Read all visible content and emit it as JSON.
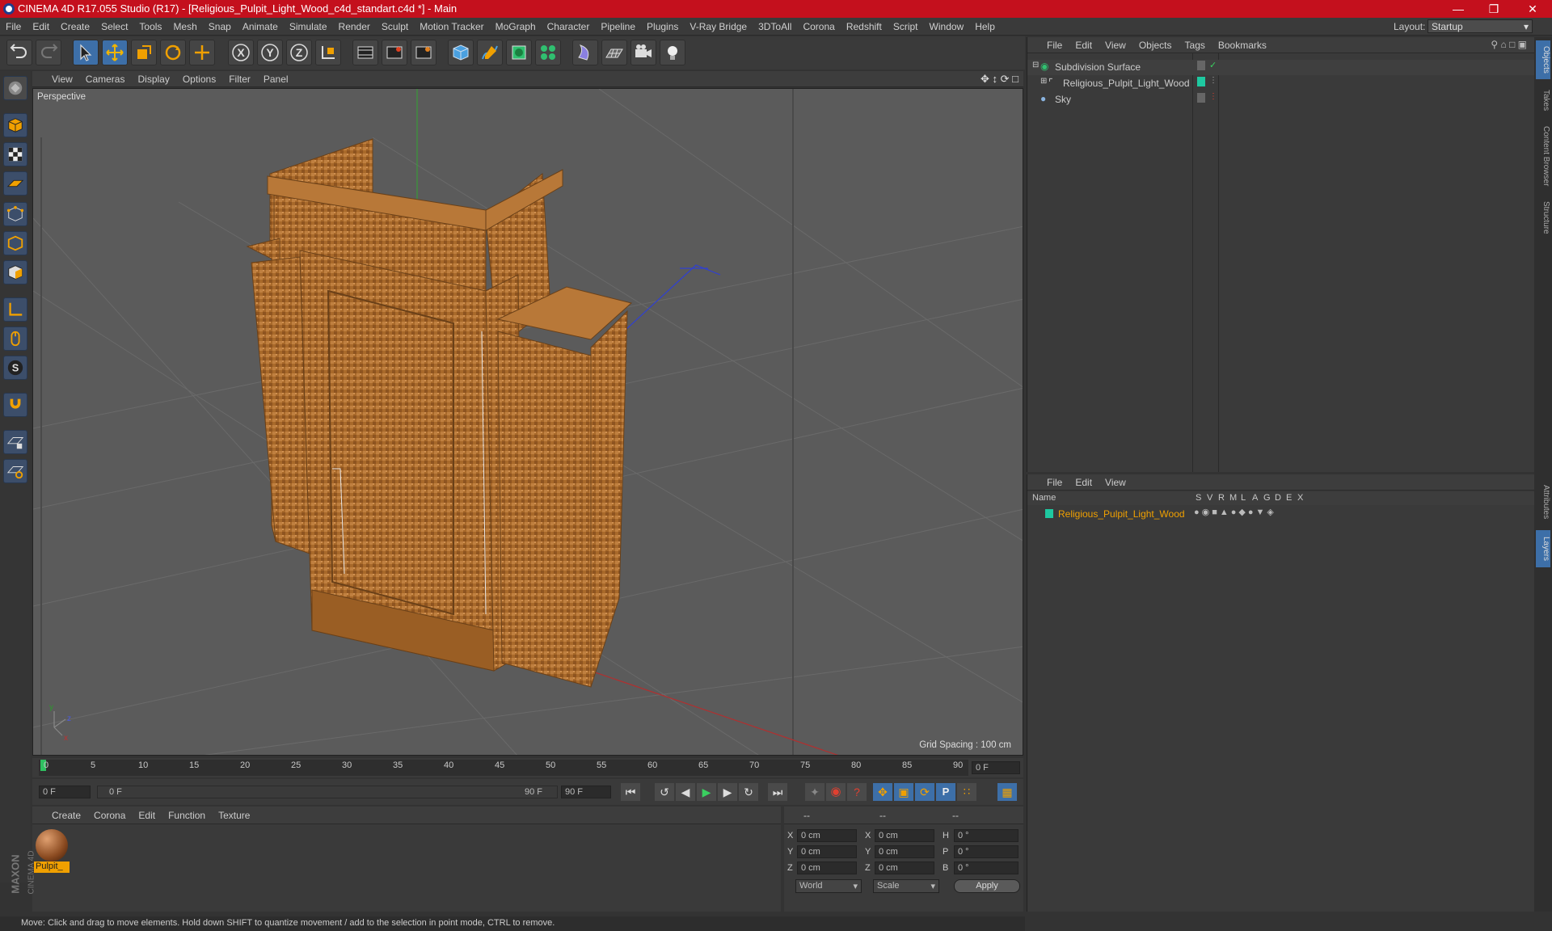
{
  "app": {
    "title": "CINEMA 4D R17.055 Studio (R17) - [Religious_Pulpit_Light_Wood_c4d_standart.c4d *] - Main"
  },
  "menubar": {
    "items": [
      "File",
      "Edit",
      "Create",
      "Select",
      "Tools",
      "Mesh",
      "Snap",
      "Animate",
      "Simulate",
      "Render",
      "Sculpt",
      "Motion Tracker",
      "MoGraph",
      "Character",
      "Pipeline",
      "Plugins",
      "V-Ray Bridge",
      "3DToAll",
      "Corona",
      "Redshift",
      "Script",
      "Window",
      "Help"
    ],
    "layout_label": "Layout:",
    "layout_value": "Startup"
  },
  "viewport": {
    "menu": [
      "View",
      "Cameras",
      "Display",
      "Options",
      "Filter",
      "Panel"
    ],
    "label": "Perspective",
    "grid_spacing": "Grid Spacing : 100 cm"
  },
  "timeline": {
    "ticks": [
      "0",
      "5",
      "10",
      "15",
      "20",
      "25",
      "30",
      "35",
      "40",
      "45",
      "50",
      "55",
      "60",
      "65",
      "70",
      "75",
      "80",
      "85",
      "90"
    ],
    "current_frame": "0 F",
    "start_field": "0 F",
    "range_start": "0 F",
    "range_end": "90 F",
    "end_field": "90 F"
  },
  "material_panel": {
    "menu": [
      "Create",
      "Corona",
      "Edit",
      "Function",
      "Texture"
    ],
    "materials": [
      {
        "name": "Pulpit_"
      }
    ]
  },
  "attributes": {
    "header": [
      "--",
      "--",
      "--"
    ],
    "rows": [
      {
        "a": "X",
        "av": "0 cm",
        "b": "X",
        "bv": "0 cm",
        "c": "H",
        "cv": "0 °"
      },
      {
        "a": "Y",
        "av": "0 cm",
        "b": "Y",
        "bv": "0 cm",
        "c": "P",
        "cv": "0 °"
      },
      {
        "a": "Z",
        "av": "0 cm",
        "b": "Z",
        "bv": "0 cm",
        "c": "B",
        "cv": "0 °"
      }
    ],
    "coord_mode": "World",
    "size_mode": "Scale",
    "apply_label": "Apply"
  },
  "status": {
    "text": "Move: Click and drag to move elements. Hold down SHIFT to quantize movement / add to the selection in point mode, CTRL to remove."
  },
  "object_manager": {
    "menu": [
      "File",
      "Edit",
      "View",
      "Objects",
      "Tags",
      "Bookmarks"
    ],
    "objects": [
      {
        "name": "Subdivision Surface"
      },
      {
        "name": "Religious_Pulpit_Light_Wood"
      },
      {
        "name": "Sky"
      }
    ]
  },
  "layer_manager": {
    "menu": [
      "File",
      "Edit",
      "View"
    ],
    "columns": [
      "Name",
      "S",
      "V",
      "R",
      "M",
      "L",
      "A",
      "G",
      "D",
      "E",
      "X"
    ],
    "layers": [
      {
        "name": "Religious_Pulpit_Light_Wood"
      }
    ]
  },
  "right_tabs": [
    "Objects",
    "Takes",
    "Content Browser",
    "Structure",
    "Attributes",
    "Layers"
  ],
  "brand": {
    "line1": "MAXON",
    "line2": "CINEMA 4D"
  },
  "colors": {
    "title_bar": "#c4101d",
    "accent_orange": "#f0a000",
    "layer_green": "#1ec8a0",
    "tool_blue": "#3d6fa8"
  },
  "toolbar": {
    "icons": [
      "undo-icon",
      "redo-icon",
      "select-arrow-icon",
      "move-icon",
      "scale-icon",
      "rotate-icon",
      "last-tool-icon",
      "x-axis-icon",
      "y-axis-icon",
      "z-axis-icon",
      "coordinate-system-icon",
      "render-view-icon",
      "render-picture-viewer-icon",
      "edit-render-settings-icon",
      "cube-primitive-icon",
      "pen-spline-icon",
      "subdivision-nurbs-icon",
      "mograph-cloner-icon",
      "deformer-icon",
      "floor-environment-icon",
      "camera-icon",
      "light-icon"
    ]
  }
}
